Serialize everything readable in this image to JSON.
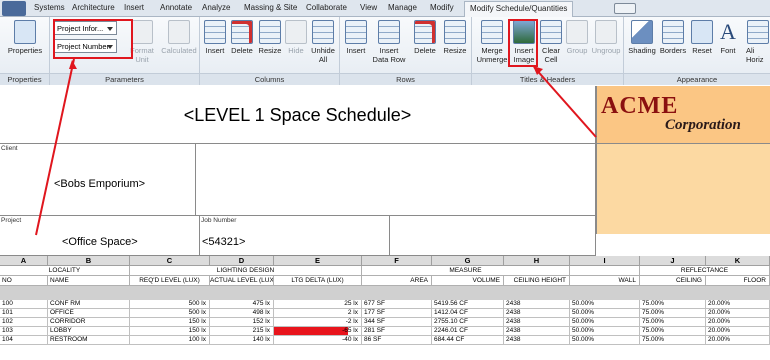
{
  "tabs": [
    "Systems",
    "Architecture",
    "Insert",
    "Annotate",
    "Analyze",
    "Massing & Site",
    "Collaborate",
    "View",
    "Manage",
    "Modify",
    "Modify Schedule/Quantities"
  ],
  "properties_panel": {
    "button": "Properties",
    "title": "Properties"
  },
  "parameters_panel": {
    "dropdown1": "Project Infor...",
    "dropdown2": "Project Number",
    "format_unit": "Format Unit",
    "calculated": "Calculated",
    "title": "Parameters"
  },
  "columns_panel": {
    "insert": "Insert",
    "delete": "Delete",
    "resize": "Resize",
    "hide": "Hide",
    "unhide_all": "Unhide All",
    "title": "Columns"
  },
  "rows_panel": {
    "insert": "Insert",
    "insert_data_row": "Insert Data Row",
    "delete": "Delete",
    "resize": "Resize",
    "title": "Rows"
  },
  "titles_panel": {
    "merge_unmerge": "Merge Unmerge",
    "insert_image": "Insert Image",
    "clear_cell": "Clear Cell",
    "group": "Group",
    "ungroup": "Ungroup",
    "title": "Titles & Headers"
  },
  "appearance_panel": {
    "shading": "Shading",
    "borders": "Borders",
    "reset": "Reset",
    "font": "Font",
    "align_horiz": "Ali Horiz",
    "title": "Appearance"
  },
  "schedule": {
    "title": "<LEVEL 1 Space Schedule>",
    "client_label": "Client",
    "client_value": "<Bobs Emporium>",
    "project_label": "Project",
    "project_value": "<Office Space>",
    "job_label": "Job Number",
    "job_value": "<54321>",
    "logo_name": "ACME",
    "logo_sub": "Corporation",
    "col_letters": [
      "A",
      "B",
      "C",
      "D",
      "E",
      "F",
      "G",
      "H",
      "I",
      "J",
      "K"
    ],
    "groups": {
      "locality": "LOCALITY",
      "lighting": "LIGHTING DESIGN",
      "measure": "MEASURE",
      "reflectance": "REFLECTANCE"
    },
    "headers": [
      "NO",
      "NAME",
      "REQ'D LEVEL (LUX)",
      "ACTUAL LEVEL (LUX)",
      "LTG DELTA (LUX)",
      "AREA",
      "VOLUME",
      "CEILING HEIGHT",
      "WALL",
      "CEILING",
      "FLOOR"
    ],
    "rows": [
      [
        "100",
        "CONF RM",
        "500 lx",
        "475 lx",
        "25 lx",
        "677 SF",
        "5419.56 CF",
        "2438",
        "50.00%",
        "75.00%",
        "20.00%"
      ],
      [
        "101",
        "OFFICE",
        "500 lx",
        "498 lx",
        "2 lx",
        "177 SF",
        "1412.04 CF",
        "2438",
        "50.00%",
        "75.00%",
        "20.00%"
      ],
      [
        "102",
        "CORRIDOR",
        "150 lx",
        "152 lx",
        "-2 lx",
        "344 SF",
        "2755.10 CF",
        "2438",
        "50.00%",
        "75.00%",
        "20.00%"
      ],
      [
        "103",
        "LOBBY",
        "150 lx",
        "215 lx",
        "-65 lx",
        "281 SF",
        "2246.01 CF",
        "2438",
        "50.00%",
        "75.00%",
        "20.00%"
      ],
      [
        "104",
        "RESTROOM",
        "100 lx",
        "140 lx",
        "-40 lx",
        "86 SF",
        "684.44 CF",
        "2438",
        "50.00%",
        "75.00%",
        "20.00%"
      ]
    ],
    "highlight_color": "#e8141c"
  }
}
